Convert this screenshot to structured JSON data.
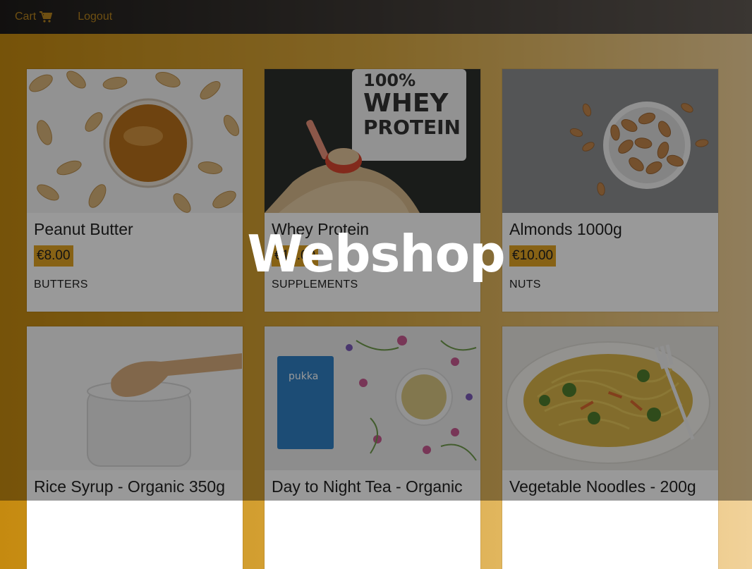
{
  "nav": {
    "cart_label": "Cart",
    "logout_label": "Logout",
    "cart_icon": "cart-icon"
  },
  "hero": {
    "title": "Webshop"
  },
  "products": [
    {
      "name": "Peanut Butter",
      "price": "€8.00",
      "category": "BUTTERS"
    },
    {
      "name": "Whey Protein",
      "price": "€17.00",
      "category": "SUPPLEMENTS"
    },
    {
      "name": "Almonds 1000g",
      "price": "€10.00",
      "category": "NUTS"
    },
    {
      "name": "Rice Syrup - Organic 350g",
      "price": "",
      "category": ""
    },
    {
      "name": "Day to Night Tea - Organic",
      "price": "",
      "category": ""
    },
    {
      "name": "Vegetable Noodles - 200g",
      "price": "",
      "category": ""
    }
  ],
  "colors": {
    "accent": "#e2a424",
    "navbar": "#2a2724",
    "background_start": "#c58a10",
    "background_end": "#f1d29a"
  }
}
